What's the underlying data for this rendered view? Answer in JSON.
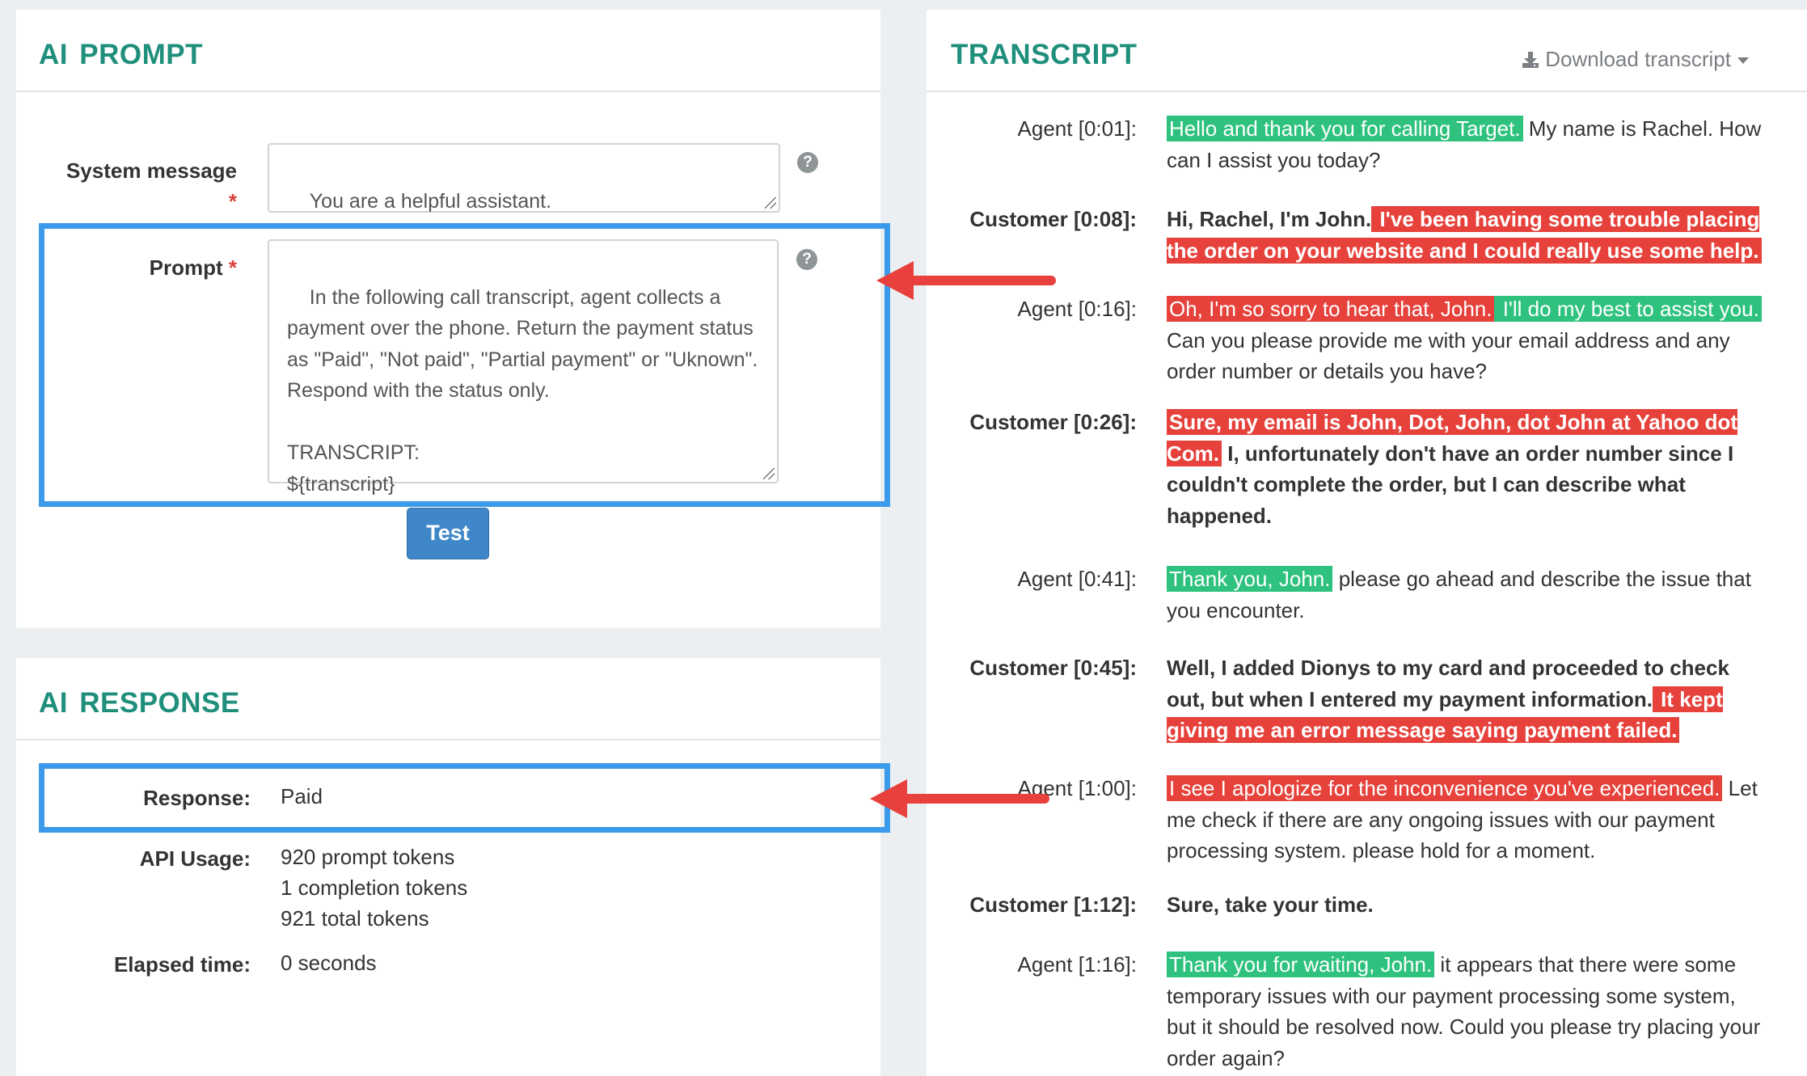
{
  "prompt_panel": {
    "title": "AI PROMPT",
    "system_label": "System message",
    "system_value": "You are a helpful assistant.",
    "prompt_label": "Prompt",
    "required_mark": "*",
    "prompt_value": "In the following call transcript, agent collects a payment over the phone. Return the payment status as \"Paid\", \"Not paid\", \"Partial payment\" or \"Uknown\". Respond with the status only.\n\nTRANSCRIPT:\n${transcript}",
    "help_glyph": "?",
    "test_button": "Test"
  },
  "response_panel": {
    "title": "AI RESPONSE",
    "response_label": "Response:",
    "response_value": "Paid",
    "usage_label": "API Usage:",
    "usage_lines": [
      "920 prompt tokens",
      "1 completion tokens",
      "921 total tokens"
    ],
    "elapsed_label": "Elapsed time:",
    "elapsed_value": "0 seconds"
  },
  "transcript_panel": {
    "title": "TRANSCRIPT",
    "download_label": "Download transcript",
    "turns": [
      {
        "speaker": "Agent [0:01]:",
        "role": "agent",
        "segments": [
          {
            "text": "Hello and thank you for calling Target.",
            "sentiment": "positive"
          },
          {
            "text": " My name is Rachel. How can I assist you today?",
            "sentiment": "neutral"
          }
        ]
      },
      {
        "speaker": "Customer [0:08]:",
        "role": "customer",
        "segments": [
          {
            "text": "Hi, Rachel, I'm John.",
            "sentiment": "neutral"
          },
          {
            "text": " I've been having some trouble placing the order on your website and I could really use some help.",
            "sentiment": "negative"
          }
        ]
      },
      {
        "speaker": "Agent [0:16]:",
        "role": "agent",
        "segments": [
          {
            "text": "Oh, I'm so sorry to hear that, John.",
            "sentiment": "negative"
          },
          {
            "text": " I'll do my best to assist you.",
            "sentiment": "positive"
          },
          {
            "text": " Can you please provide me with your email address and any order number or details you have?",
            "sentiment": "neutral"
          }
        ]
      },
      {
        "speaker": "Customer [0:26]:",
        "role": "customer",
        "segments": [
          {
            "text": "Sure, my email is John, Dot, John, dot John at Yahoo dot Com.",
            "sentiment": "negative"
          },
          {
            "text": " I, unfortunately don't have an order number since I couldn't complete the order, but I can describe what happened.",
            "sentiment": "neutral"
          }
        ]
      },
      {
        "speaker": "Agent [0:41]:",
        "role": "agent",
        "segments": [
          {
            "text": "Thank you, John.",
            "sentiment": "positive"
          },
          {
            "text": " please go ahead and describe the issue that you encounter.",
            "sentiment": "neutral"
          }
        ]
      },
      {
        "speaker": "Customer [0:45]:",
        "role": "customer",
        "segments": [
          {
            "text": "Well, I added Dionys to my card and proceeded to check out, but when I entered my payment information.",
            "sentiment": "neutral"
          },
          {
            "text": " It kept giving me an error message saying payment failed.",
            "sentiment": "negative"
          }
        ]
      },
      {
        "speaker": "Agent [1:00]:",
        "role": "agent",
        "segments": [
          {
            "text": "I see I apologize for the inconvenience you've experienced.",
            "sentiment": "negative"
          },
          {
            "text": " Let me check if there are any ongoing issues with our payment processing system. please hold for a moment.",
            "sentiment": "neutral"
          }
        ]
      },
      {
        "speaker": "Customer [1:12]:",
        "role": "customer",
        "segments": [
          {
            "text": "Sure, take your time.",
            "sentiment": "neutral"
          }
        ]
      },
      {
        "speaker": "Agent [1:16]:",
        "role": "agent",
        "segments": [
          {
            "text": "Thank you for waiting, John.",
            "sentiment": "positive"
          },
          {
            "text": " it appears that there were some temporary issues with our payment processing some system, but it should be resolved now. Could you please try placing your order again?",
            "sentiment": "neutral"
          }
        ]
      }
    ]
  },
  "colors": {
    "title_green": "#1f8f7c",
    "highlight_box_blue": "#3b9bea",
    "arrow_red": "#e8413d",
    "positive_green": "#2ec27e",
    "negative_red": "#e6413b",
    "button_blue": "#3f87c8"
  }
}
